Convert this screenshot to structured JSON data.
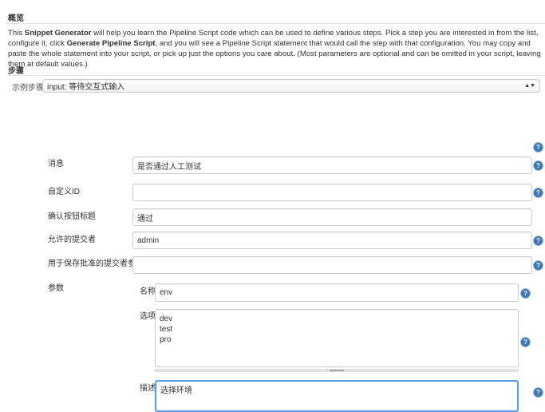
{
  "overview": {
    "heading": "概览",
    "p1": "This ",
    "bold1": "Snippet Generator",
    "p2": " will help you learn the Pipeline Script code which can be used to define various steps. Pick a step you are interested in from the list, configure it, click ",
    "bold2": "Generate Pipeline Script",
    "p3": ", and you will see a Pipeline Script statement that would call the step with that configuration. You may copy and paste the whole statement into your script, or pick up just the options you care about. (Most parameters are optional and can be omitted in your script, leaving them at default values.)"
  },
  "steps": {
    "heading": "步骤",
    "sample_label": "示例步骤",
    "sample_value": "input: 等待交互式输入"
  },
  "form": {
    "message": {
      "label": "消息",
      "value": "是否通过人工测试"
    },
    "custom_id": {
      "label": "自定义ID",
      "value": ""
    },
    "ok_label": {
      "label": "确认按钮标题",
      "value": "通过"
    },
    "submitter": {
      "label": "允许的提交者",
      "value": "admin"
    },
    "submitter_param": {
      "label": "用于保存批准的提交者参数",
      "value": ""
    },
    "params": {
      "label": "参数",
      "name_label": "名称",
      "name_value": "env",
      "choices_label": "选项",
      "choices_value": "dev\ntest\npro",
      "desc_label": "描述",
      "desc_value": "选择环境"
    }
  },
  "help_icon": "?"
}
